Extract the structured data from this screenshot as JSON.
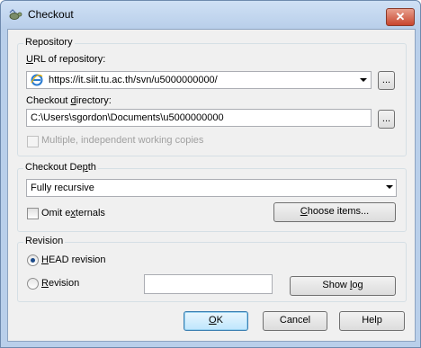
{
  "window": {
    "title": "Checkout",
    "close_glyph": "✕",
    "icon": "svn-turtle-icon"
  },
  "repository": {
    "group_title": "Repository",
    "url_label": "URL of repository:",
    "url_value": "https://it.siit.tu.ac.th/svn/u5000000000/",
    "checkout_dir_label": "Checkout directory:",
    "checkout_dir_value": "C:\\Users\\sgordon\\Documents\\u5000000000",
    "browse_label": "...",
    "multiple_label": "Multiple, independent working copies"
  },
  "depth": {
    "group_title": "Checkout Depth",
    "selected": "Fully recursive",
    "omit_externals_label": "Omit externals",
    "choose_items_label": "Choose items..."
  },
  "revision": {
    "group_title": "Revision",
    "head_label": "HEAD revision",
    "revision_label": "Revision",
    "revision_value": "",
    "show_log_label": "Show log"
  },
  "buttons": {
    "ok": "OK",
    "cancel": "Cancel",
    "help": "Help"
  }
}
